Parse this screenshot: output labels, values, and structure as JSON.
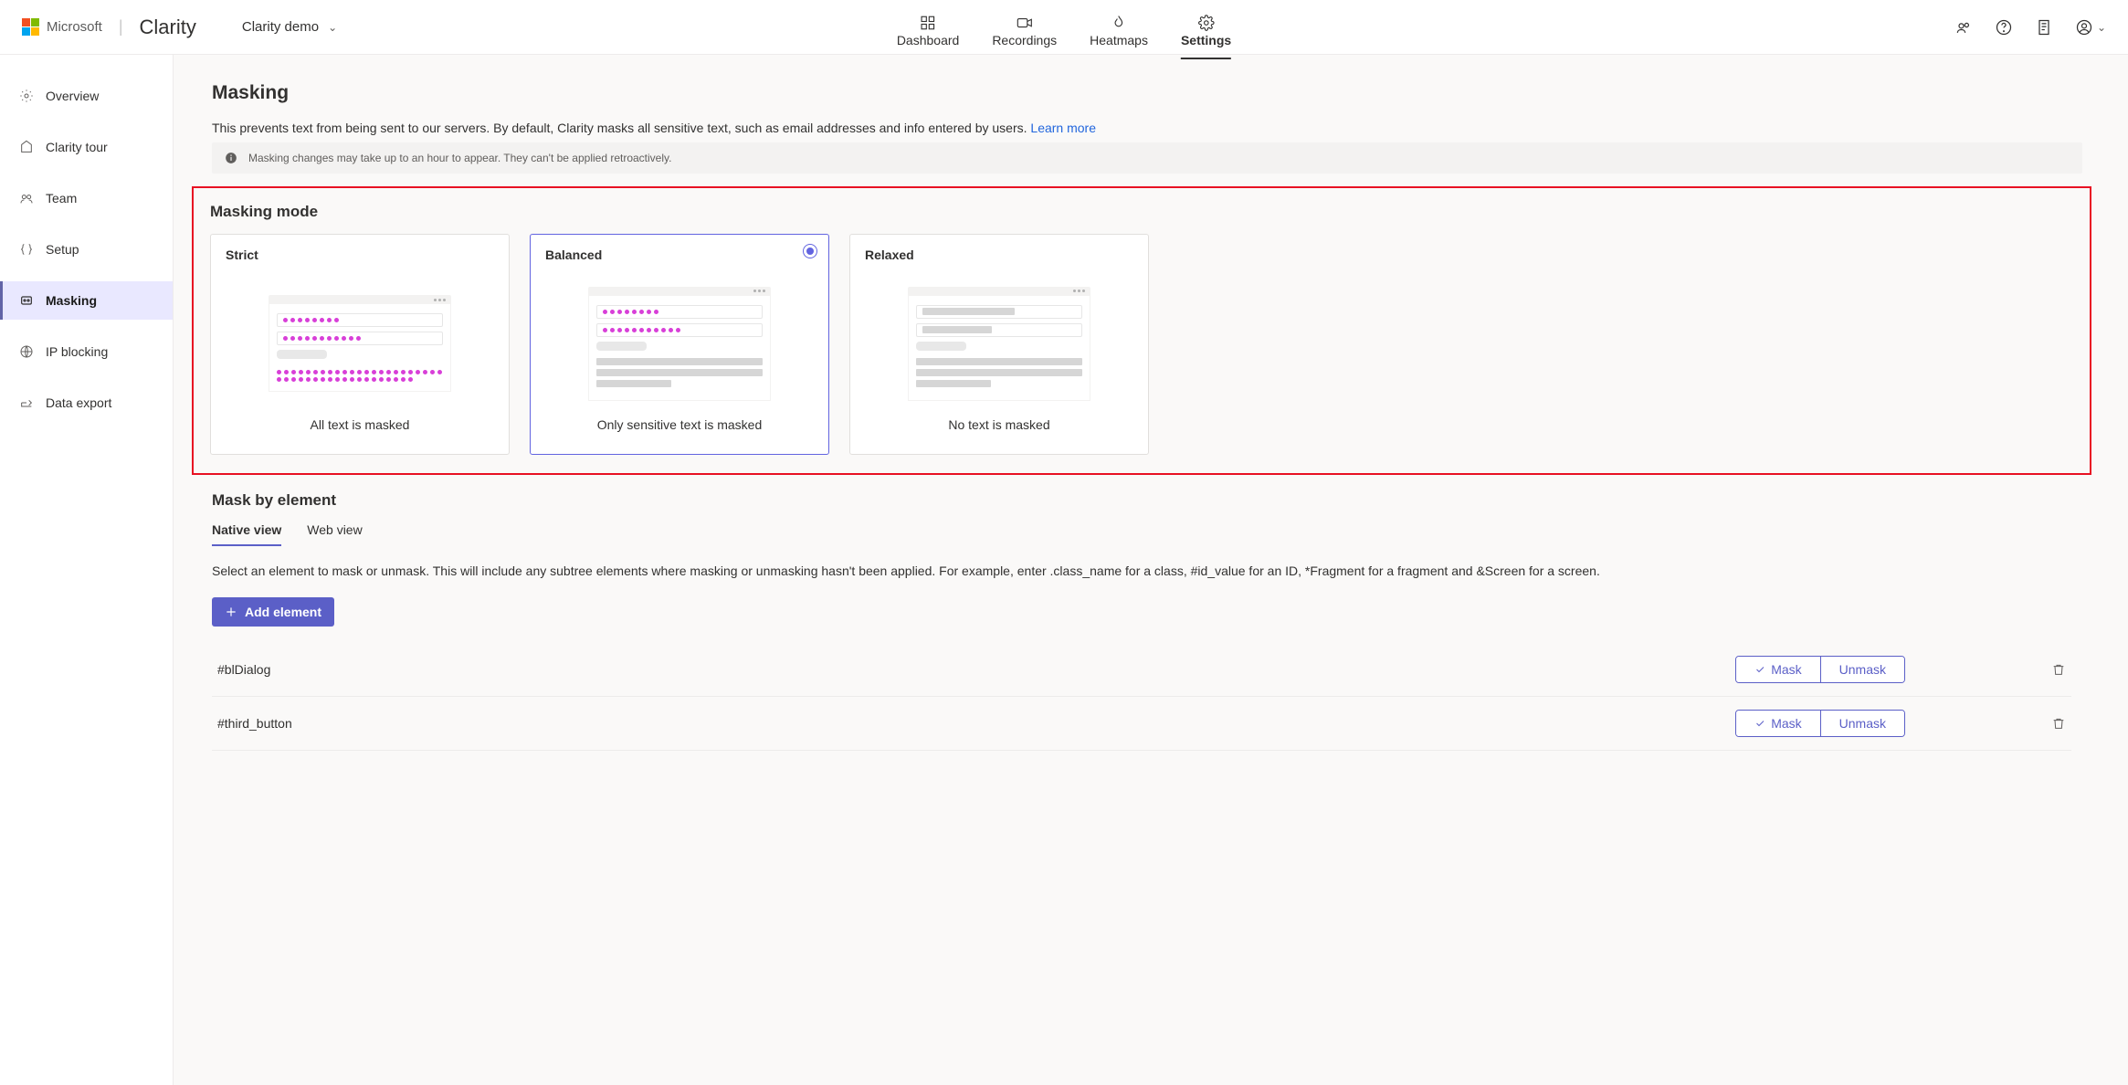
{
  "header": {
    "brand_ms": "Microsoft",
    "brand_app": "Clarity",
    "project_name": "Clarity demo",
    "nav": [
      {
        "label": "Dashboard",
        "icon": "dashboard-icon"
      },
      {
        "label": "Recordings",
        "icon": "video-icon"
      },
      {
        "label": "Heatmaps",
        "icon": "flame-icon"
      },
      {
        "label": "Settings",
        "icon": "gear-icon"
      }
    ]
  },
  "sidebar": {
    "items": [
      {
        "label": "Overview"
      },
      {
        "label": "Clarity tour"
      },
      {
        "label": "Team"
      },
      {
        "label": "Setup"
      },
      {
        "label": "Masking"
      },
      {
        "label": "IP blocking"
      },
      {
        "label": "Data export"
      }
    ]
  },
  "page": {
    "title": "Masking",
    "description": "This prevents text from being sent to our servers. By default, Clarity masks all sensitive text, such as email addresses and info entered by users. ",
    "learn_more": "Learn more",
    "alert": "Masking changes may take up to an hour to appear. They can't be applied retroactively."
  },
  "masking_mode": {
    "title": "Masking mode",
    "cards": [
      {
        "title": "Strict",
        "caption": "All text is masked"
      },
      {
        "title": "Balanced",
        "caption": "Only sensitive text is masked"
      },
      {
        "title": "Relaxed",
        "caption": "No text is masked"
      }
    ]
  },
  "mask_by_element": {
    "title": "Mask by element",
    "tabs": [
      "Native view",
      "Web view"
    ],
    "desc": "Select an element to mask or unmask. This will include any subtree elements where masking or unmasking hasn't been applied. For example, enter .class_name for a class, #id_value for an ID, *Fragment for a fragment and &Screen for a screen.",
    "add_label": "Add element",
    "mask_label": "Mask",
    "unmask_label": "Unmask",
    "rows": [
      {
        "selector": "#blDialog"
      },
      {
        "selector": "#third_button"
      }
    ]
  }
}
